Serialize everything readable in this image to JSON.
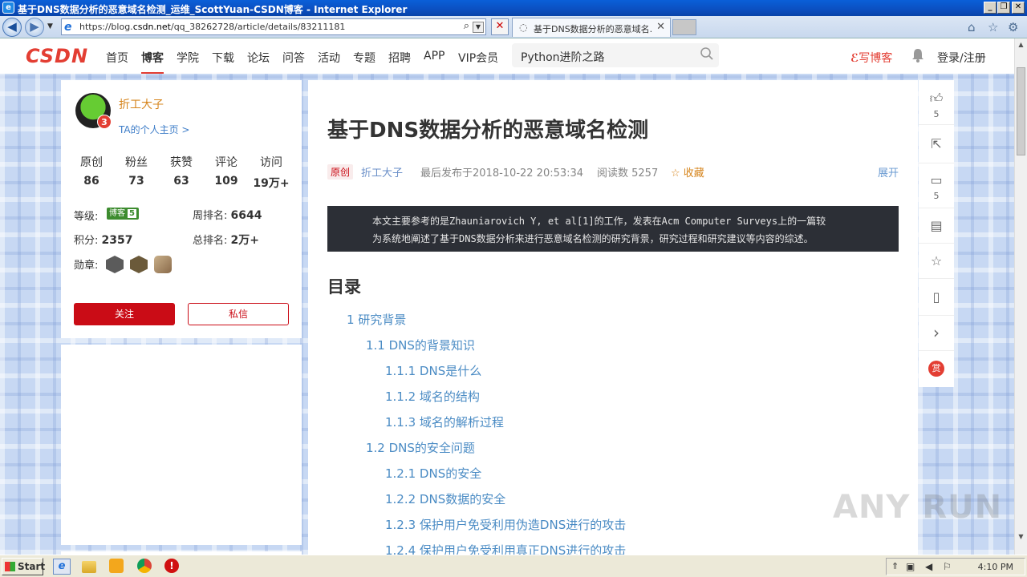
{
  "window": {
    "title": "基于DNS数据分析的恶意域名检测_运维_ScottYuan-CSDN博客 - Internet Explorer"
  },
  "browser": {
    "url_prefix": "https://blog.",
    "url_host": "csdn.net",
    "url_path": "/qq_38262728/article/details/83211181",
    "tab_title": "基于DNS数据分析的恶意域名...",
    "icons": [
      "back-icon",
      "forward-icon",
      "search-icon",
      "stop-icon",
      "home-icon",
      "favorites-icon",
      "tools-icon"
    ]
  },
  "csdn": {
    "logo": "CSDN",
    "nav": [
      "首页",
      "博客",
      "学院",
      "下载",
      "论坛",
      "问答",
      "活动",
      "专题",
      "招聘",
      "APP",
      "VIP会员"
    ],
    "active_nav": "博客",
    "search_text": "Python进阶之路",
    "write_blog": "写博客",
    "login": "登录/注册",
    "accent": "#e33e33"
  },
  "profile": {
    "name": "折工大子",
    "home_link": "TA的个人主页 >",
    "level_num": "3",
    "stats": [
      {
        "label": "原创",
        "value": "86"
      },
      {
        "label": "粉丝",
        "value": "73"
      },
      {
        "label": "获赞",
        "value": "63"
      },
      {
        "label": "评论",
        "value": "109"
      },
      {
        "label": "访问",
        "value": "19万+"
      }
    ],
    "level_label": "等级:",
    "level_badge": "博客",
    "level_badge_num": "5",
    "week_rank_label": "周排名:",
    "week_rank": "6644",
    "points_label": "积分:",
    "points": "2357",
    "total_rank_label": "总排名:",
    "total_rank": "2万+",
    "medals_label": "勋章:",
    "follow": "关注",
    "message": "私信"
  },
  "article": {
    "title": "基于DNS数据分析的恶意域名检测",
    "tag": "原创",
    "author": "折工大子",
    "date": "最后发布于2018-10-22 20:53:34",
    "reads": "阅读数 5257",
    "favorite": "收藏",
    "expand": "展开",
    "summary_1": "本文主要参考的是Zhauniarovich Y, et al[1]的工作，发表在Acm Computer Surveys上的一篇较",
    "summary_2": "为系统地阐述了基于DNS数据分析来进行恶意域名检测的研究背景，研究过程和研究建议等内容的综述。",
    "toc_heading": "目录",
    "toc": [
      {
        "text": "1 研究背景",
        "level": 1
      },
      {
        "text": "1.1 DNS的背景知识",
        "level": 2
      },
      {
        "text": "1.1.1 DNS是什么",
        "level": 3
      },
      {
        "text": "1.1.2 域名的结构",
        "level": 3
      },
      {
        "text": "1.1.3 域名的解析过程",
        "level": 3
      },
      {
        "text": "1.2 DNS的安全问题",
        "level": 2
      },
      {
        "text": "1.2.1 DNS的安全",
        "level": 3
      },
      {
        "text": "1.2.2 DNS数据的安全",
        "level": 3
      },
      {
        "text": "1.2.3 保护用户免受利用伪造DNS进行的攻击",
        "level": 3
      },
      {
        "text": "1.2.4 保护用户免受利用真正DNS进行的攻击",
        "level": 3
      }
    ]
  },
  "toolbar": {
    "likes": "5",
    "comments": "5",
    "reward": "赏"
  },
  "watermark": "ANY RUN",
  "taskbar": {
    "start": "Start",
    "clock": "4:10 PM"
  }
}
